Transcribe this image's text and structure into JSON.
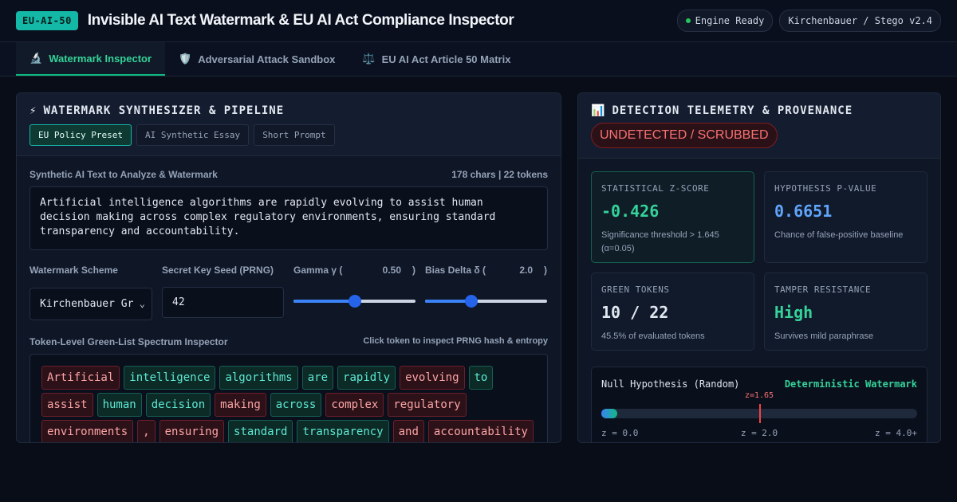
{
  "header": {
    "badge": "EU-AI-50",
    "title": "Invisible AI Text Watermark & EU AI Act Compliance Inspector",
    "engine_status": "Engine Ready",
    "engine_version": "Kirchenbauer / Stego v2.4"
  },
  "tabs": [
    {
      "label": "Watermark Inspector",
      "icon": "microscope-icon",
      "glyph": "🔬",
      "active": true
    },
    {
      "label": "Adversarial Attack Sandbox",
      "icon": "shield-icon",
      "glyph": "🛡️",
      "active": false
    },
    {
      "label": "EU AI Act Article 50 Matrix",
      "icon": "scales-icon",
      "glyph": "⚖️",
      "active": false
    }
  ],
  "left": {
    "title": "WATERMARK SYNTHESIZER & PIPELINE",
    "title_icon": "⚡",
    "presets": [
      "EU Policy Preset",
      "AI Synthetic Essay",
      "Short Prompt"
    ],
    "input_label": "Synthetic AI Text to Analyze & Watermark",
    "input_stats": "178 chars | 22 tokens",
    "input_text": "Artificial intelligence algorithms are rapidly evolving to assist human decision making across complex regulatory environments, ensuring standard transparency and accountability.",
    "scheme_label": "Watermark Scheme",
    "scheme_value": "Kirchenbauer Gr",
    "seed_label": "Secret Key Seed (PRNG)",
    "seed_value": "42",
    "gamma_label": "Gamma γ (",
    "gamma_value": "0.50",
    "gamma_close": ")",
    "gamma_fraction": 0.5,
    "delta_label": "Bias Delta δ (",
    "delta_value": "2.0",
    "delta_close": ")",
    "delta_fraction": 0.38,
    "tokens_label": "Token-Level Green-List Spectrum Inspector",
    "tokens_hint": "Click token to inspect PRNG hash & entropy",
    "tokens": [
      {
        "t": "Artificial",
        "g": false
      },
      {
        "t": "intelligence",
        "g": true
      },
      {
        "t": "algorithms",
        "g": true
      },
      {
        "t": "are",
        "g": true
      },
      {
        "t": "rapidly",
        "g": true
      },
      {
        "t": "evolving",
        "g": false
      },
      {
        "t": "to",
        "g": true
      },
      {
        "t": "assist",
        "g": false
      },
      {
        "t": "human",
        "g": true
      },
      {
        "t": "decision",
        "g": true
      },
      {
        "t": "making",
        "g": false
      },
      {
        "t": "across",
        "g": true
      },
      {
        "t": "complex",
        "g": false
      },
      {
        "t": "regulatory",
        "g": false
      },
      {
        "t": "environments",
        "g": false
      },
      {
        "t": ",",
        "g": false
      },
      {
        "t": "ensuring",
        "g": false
      },
      {
        "t": "standard",
        "g": true
      },
      {
        "t": "transparency",
        "g": true
      },
      {
        "t": "and",
        "g": false
      },
      {
        "t": "accountability",
        "g": false
      }
    ]
  },
  "right": {
    "title": "DETECTION TELEMETRY & PROVENANCE",
    "title_icon": "📊",
    "status": "UNDETECTED / SCRUBBED",
    "stats": [
      {
        "label": "STATISTICAL Z-SCORE",
        "value": "-0.426",
        "sub": "Significance threshold > 1.645 (α=0.05)",
        "color": "green"
      },
      {
        "label": "HYPOTHESIS P-VALUE",
        "value": "0.6651",
        "sub": "Chance of false-positive baseline",
        "color": "blue"
      },
      {
        "label": "GREEN TOKENS",
        "value": "10 / 22",
        "sub": "45.5% of evaluated tokens",
        "color": "white"
      },
      {
        "label": "TAMPER RESISTANCE",
        "value": "High",
        "sub": "Survives mild paraphrase",
        "color": "green"
      }
    ],
    "dist": {
      "left_label": "Null Hypothesis (Random)",
      "right_label": "Deterministic Watermark",
      "marker_label": "z=1.65",
      "marker_fraction": 0.5,
      "fill_fraction": 0.05,
      "axis": [
        "z = 0.0",
        "z = 2.0",
        "z = 4.0+"
      ]
    }
  },
  "colors": {
    "accent": "#10b981",
    "danger": "#f87171",
    "info": "#60a5fa"
  }
}
